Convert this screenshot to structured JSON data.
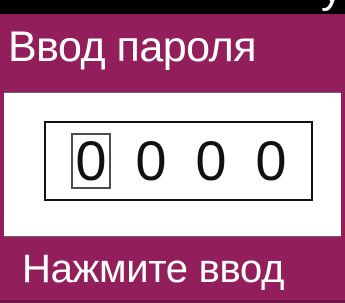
{
  "header": {
    "title": "Ввод пароля",
    "partial_glyph": "у"
  },
  "pin": {
    "digits": [
      "0",
      "0",
      "0",
      "0"
    ],
    "selected_index": 0
  },
  "footer": {
    "hint": "Нажмите ввод"
  },
  "colors": {
    "accent": "#931e5c",
    "background": "#ffffff",
    "text_light": "#ffffff",
    "text_dark": "#111111"
  }
}
